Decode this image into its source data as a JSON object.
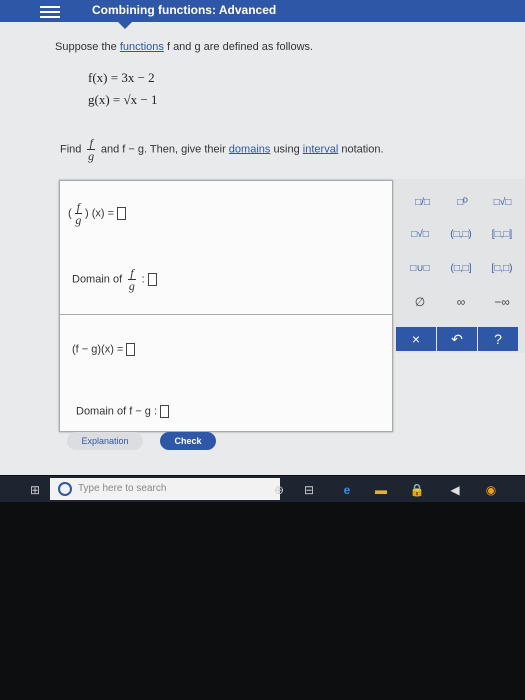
{
  "header": {
    "title": "Combining functions: Advanced"
  },
  "problem": {
    "intro_a": "Suppose",
    "intro_b": "the",
    "link_functions": "functions",
    "intro_c": "f and g are defined as follows.",
    "eq1": "f(x)  = 3x − 2",
    "eq2": "g(x)  = √x − 1",
    "find_a": "Find",
    "frac_num": "f",
    "frac_den": "g",
    "find_b": "and f − g. Then, give their",
    "link_domains": "domains",
    "find_c": "using",
    "link_interval": "interval",
    "find_d": "notation."
  },
  "answer": {
    "fg_rhs": "(x) =",
    "domain_of": "Domain of",
    "domain_colon": ":",
    "fminusg": "(f − g)(x) =",
    "domain_fmg": "Domain of f − g :"
  },
  "keypad": {
    "r1": [
      "□/□",
      "□ᴰ",
      "□√□"
    ],
    "r2": [
      "□√□",
      "(□,□)",
      "[□,□]"
    ],
    "r3": [
      "□∪□",
      "(□,□]",
      "[□,□)"
    ],
    "r4": [
      "∅",
      "∞",
      "−∞"
    ],
    "r5": [
      "×",
      "↶",
      "?"
    ]
  },
  "buttons": {
    "explanation": "Explanation",
    "check": "Check"
  },
  "taskbar": {
    "search_placeholder": "Type here to search",
    "windows_icon": "⊞",
    "pin_icon": "⊕",
    "task_icon": "⊟",
    "edge_icon": "e",
    "folder_icon": "▬",
    "store_icon": "🔒",
    "mail_icon": "◀",
    "chrome_icon": "◉"
  },
  "colors": {
    "accent": "#2f57a7"
  }
}
